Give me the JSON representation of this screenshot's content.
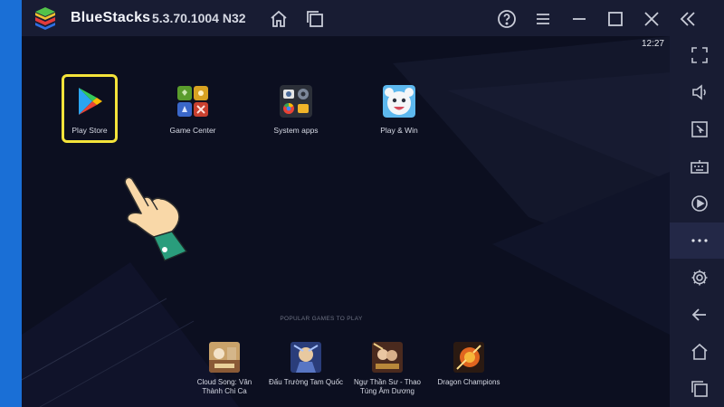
{
  "titlebar": {
    "app_name": "BlueStacks",
    "version": "5.3.70.1004  N32",
    "icons": [
      "home-icon",
      "multi-instance-icon",
      "help-icon",
      "menu-icon",
      "minimize-icon",
      "maximize-icon",
      "close-icon",
      "collapse-sidebar-icon"
    ]
  },
  "status": {
    "time": "12:27"
  },
  "apps": [
    {
      "label": "Play Store",
      "icon": "play-store-icon"
    },
    {
      "label": "Game Center",
      "icon": "game-center-icon"
    },
    {
      "label": "System apps",
      "icon": "system-apps-icon"
    },
    {
      "label": "Play & Win",
      "icon": "play-and-win-icon"
    }
  ],
  "popular": {
    "heading": "POPULAR GAMES TO PLAY",
    "games": [
      {
        "line1": "Cloud Song: Vân",
        "line2": "Thành Chi Ca"
      },
      {
        "line1": "Đấu Trường Tam Quốc",
        "line2": ""
      },
      {
        "line1": "Ngự Thần Sư - Thao",
        "line2": "Túng Âm Dương"
      },
      {
        "line1": "Dragon Champions",
        "line2": ""
      }
    ]
  },
  "sidebar": {
    "icons": [
      "fullscreen-icon",
      "volume-icon",
      "pointer-icon",
      "keyboard-icon",
      "record-icon",
      "more-icon",
      "settings-icon",
      "back-icon",
      "android-home-icon",
      "recent-apps-icon"
    ]
  },
  "colors": {
    "titlebar_bg": "#181c33",
    "screen_bg": "#0c0f20",
    "highlight": "#f4e33a",
    "desktop_blue": "#1a6fd6"
  }
}
